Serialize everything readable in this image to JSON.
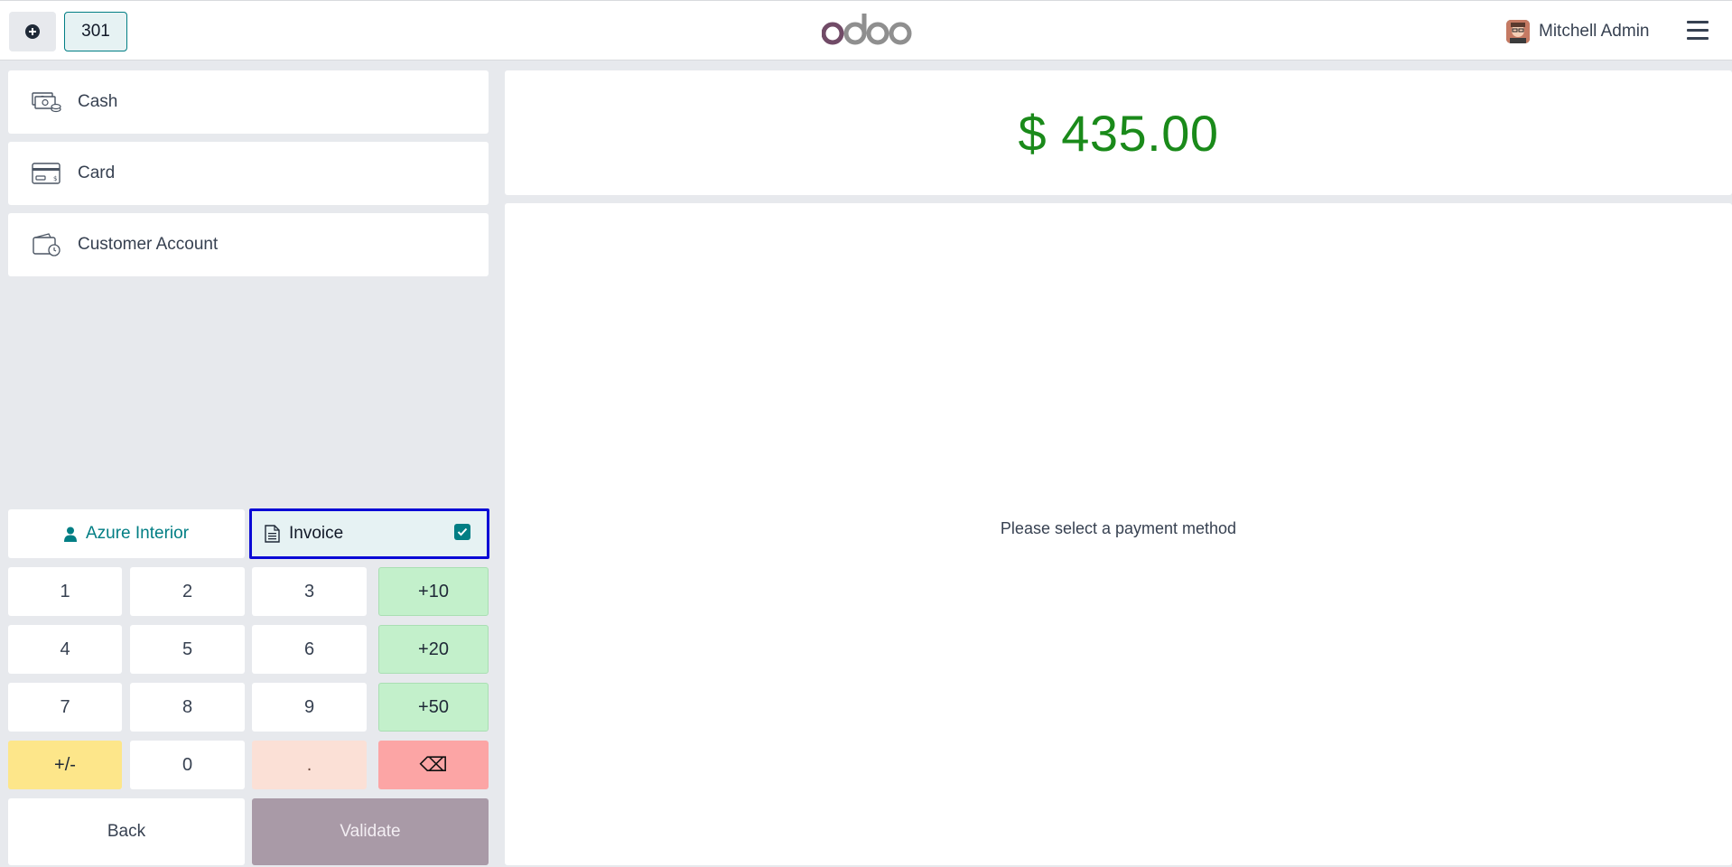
{
  "header": {
    "order_number": "301",
    "logo_text": "odoo",
    "user_name": "Mitchell Admin"
  },
  "payment_methods": [
    {
      "label": "Cash",
      "icon": "cash-icon"
    },
    {
      "label": "Card",
      "icon": "card-icon"
    },
    {
      "label": "Customer Account",
      "icon": "wallet-clock-icon"
    }
  ],
  "customer": {
    "name": "Azure Interior"
  },
  "invoice": {
    "label": "Invoice",
    "checked": true
  },
  "numpad": {
    "rows": [
      [
        "1",
        "2",
        "3",
        "+10"
      ],
      [
        "4",
        "5",
        "6",
        "+20"
      ],
      [
        "7",
        "8",
        "9",
        "+50"
      ],
      [
        "+/-",
        "0",
        ".",
        "⌫"
      ]
    ]
  },
  "actions": {
    "back_label": "Back",
    "validate_label": "Validate"
  },
  "summary": {
    "total": "$ 435.00",
    "hint": "Please select a payment method"
  },
  "colors": {
    "accent": "#017e84",
    "total_green": "#1a8a1a",
    "highlight_border": "#0a0ad6",
    "validate_disabled": "#a99aa7"
  }
}
